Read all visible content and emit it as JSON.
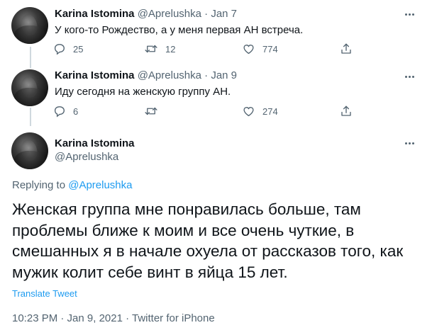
{
  "tweets": [
    {
      "name": "Karina Istomina",
      "handle": "@Aprelushka",
      "sep": "·",
      "date": "Jan 7",
      "text": "У кого-то Рождество, а у меня первая АН встреча.",
      "replies": "25",
      "retweets": "12",
      "likes": "774"
    },
    {
      "name": "Karina Istomina",
      "handle": "@Aprelushka",
      "sep": "·",
      "date": "Jan 9",
      "text": "Иду сегодня на женскую группу АН.",
      "replies": "6",
      "retweets": "",
      "likes": "274"
    }
  ],
  "main": {
    "name": "Karina Istomina",
    "handle": "@Aprelushka",
    "replying_prefix": "Replying to",
    "replying_to": "@Aprelushka",
    "lines": [
      "Женская группа мне понравилась больше, там",
      "проблемы ближе к моим и все очень чуткие, в",
      "смешанных я в начале охуела от рассказов того, как",
      "мужик колит себе винт в яйца 15 лет."
    ],
    "translate": "Translate Tweet",
    "meta": "10:23 PM · Jan 9, 2021 · Twitter for iPhone"
  },
  "colors": {
    "text": "#0f1419",
    "secondary": "#536471",
    "accent": "#1d9bf0",
    "thread_line": "#cfd9de"
  },
  "icons": [
    "reply-icon",
    "retweet-icon",
    "like-icon",
    "share-icon",
    "more-icon"
  ]
}
